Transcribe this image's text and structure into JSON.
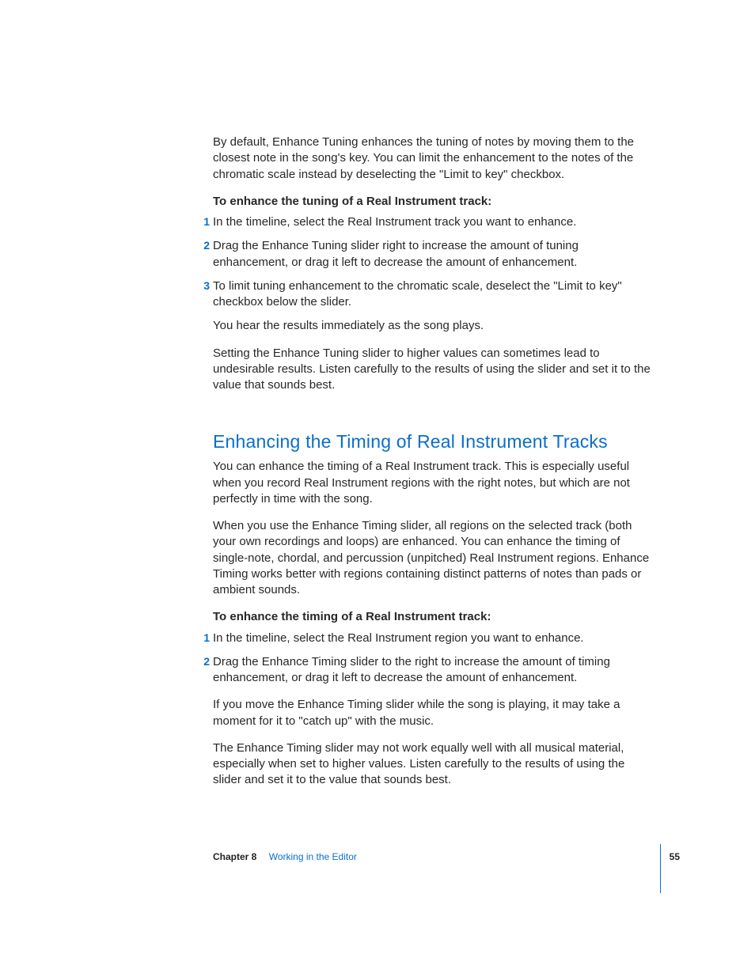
{
  "intro": {
    "para1": "By default, Enhance Tuning enhances the tuning of notes by moving them to the closest note in the song's key. You can limit the enhancement to the notes of the chromatic scale instead by deselecting the \"Limit to key\" checkbox."
  },
  "tuning": {
    "proc_title": "To enhance the tuning of a Real Instrument track:",
    "steps": [
      "In the timeline, select the Real Instrument track you want to enhance.",
      "Drag the Enhance Tuning slider right to increase the amount of tuning enhancement, or drag it left to decrease the amount of enhancement.",
      "To limit tuning enhancement to the chromatic scale, deselect the \"Limit to key\" checkbox below the slider."
    ],
    "after1": "You hear the results immediately as the song plays.",
    "after2": "Setting the Enhance Tuning slider to higher values can sometimes lead to undesirable results. Listen carefully to the results of using the slider and set it to the value that sounds best."
  },
  "section": {
    "heading": "Enhancing the Timing of Real Instrument Tracks",
    "para1": "You can enhance the timing of a Real Instrument track.  This is especially useful when you record Real Instrument regions with the right notes, but which are not perfectly in time with the song.",
    "para2": "When you use the Enhance Timing slider, all regions on the selected track (both your own recordings and loops) are enhanced. You can enhance the timing of single-note, chordal, and percussion (unpitched) Real Instrument regions. Enhance Timing works better with regions containing distinct patterns of notes than pads or ambient sounds."
  },
  "timing": {
    "proc_title": "To enhance the timing of a Real Instrument track:",
    "steps": [
      "In the timeline, select the Real Instrument region you want to enhance.",
      "Drag the Enhance Timing slider to the right to increase the amount of timing enhancement, or drag it left to decrease the amount of enhancement."
    ],
    "after1": "If you move the Enhance Timing slider while the song is playing, it may take a moment for it to \"catch up\" with the music.",
    "after2": "The Enhance Timing slider may not work equally well with all musical material, especially when set to higher values. Listen carefully to the results of using the slider and set it to the value that sounds best."
  },
  "footer": {
    "chapter_label": "Chapter 8",
    "chapter_title": "Working in the Editor",
    "page_number": "55"
  }
}
